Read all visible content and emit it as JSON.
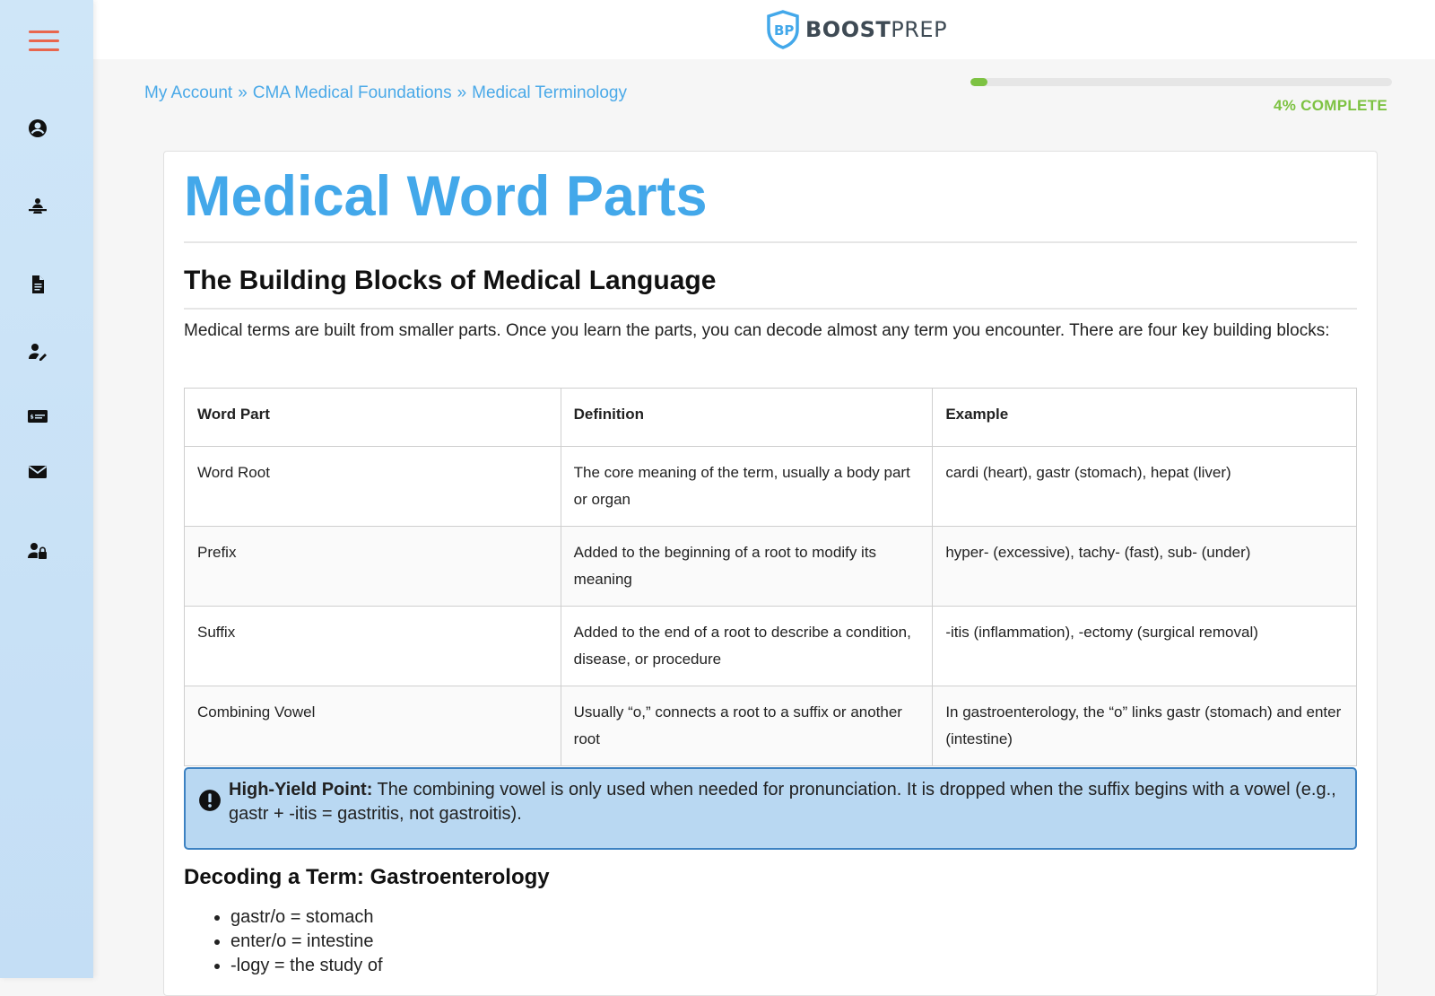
{
  "header": {
    "logo_bold": "BOOST",
    "logo_light": "PREP"
  },
  "breadcrumb": {
    "items": [
      "My Account",
      "CMA Medical Foundations",
      "Medical Terminology"
    ],
    "separator": "»"
  },
  "progress": {
    "percent": 4,
    "label": "4% COMPLETE",
    "color": "#7dc242"
  },
  "sidebar": {
    "icons": [
      "account-circle-icon",
      "tutor-icon",
      "document-icon",
      "user-edit-icon",
      "billing-card-icon",
      "mail-icon",
      "user-lock-icon"
    ],
    "accent": "#e8664e"
  },
  "content": {
    "title": "Medical Word Parts",
    "section_title": "The Building Blocks of Medical Language",
    "intro": "Medical terms are built from smaller parts. Once you learn the parts, you can decode almost any term you encounter. There are four key building blocks:",
    "table": {
      "headers": [
        "Word Part",
        "Definition",
        "Example"
      ],
      "rows": [
        [
          "Word Root",
          "The core meaning of the term, usually a body part or organ",
          "cardi (heart), gastr (stomach), hepat (liver)"
        ],
        [
          "Prefix",
          "Added to the beginning of a root to modify its meaning",
          "hyper- (excessive), tachy- (fast), sub- (under)"
        ],
        [
          "Suffix",
          "Added to the end of a root to describe a condition, disease, or procedure",
          "-itis (inflammation), -ectomy (surgical removal)"
        ],
        [
          "Combining Vowel",
          "Usually “o,” connects a root to a suffix or another root",
          "In gastroenterology, the “o” links gastr (stomach) and enter (intestine)"
        ]
      ]
    },
    "callout": {
      "label": "High-Yield Point:",
      "text": " The combining vowel is only used when needed for pronunciation. It is dropped when the suffix begins with a vowel (e.g., gastr + -itis = gastritis, not gastroitis)."
    },
    "decode_title": "Decoding a Term: Gastroenterology",
    "decode_items": [
      "gastr/o = stomach",
      "enter/o = intestine",
      "-logy = the study of"
    ]
  },
  "colors": {
    "title_blue": "#43a8ea",
    "link_blue": "#4aa9e8",
    "callout_bg": "#b9d8f2",
    "callout_border": "#3d82c2"
  }
}
